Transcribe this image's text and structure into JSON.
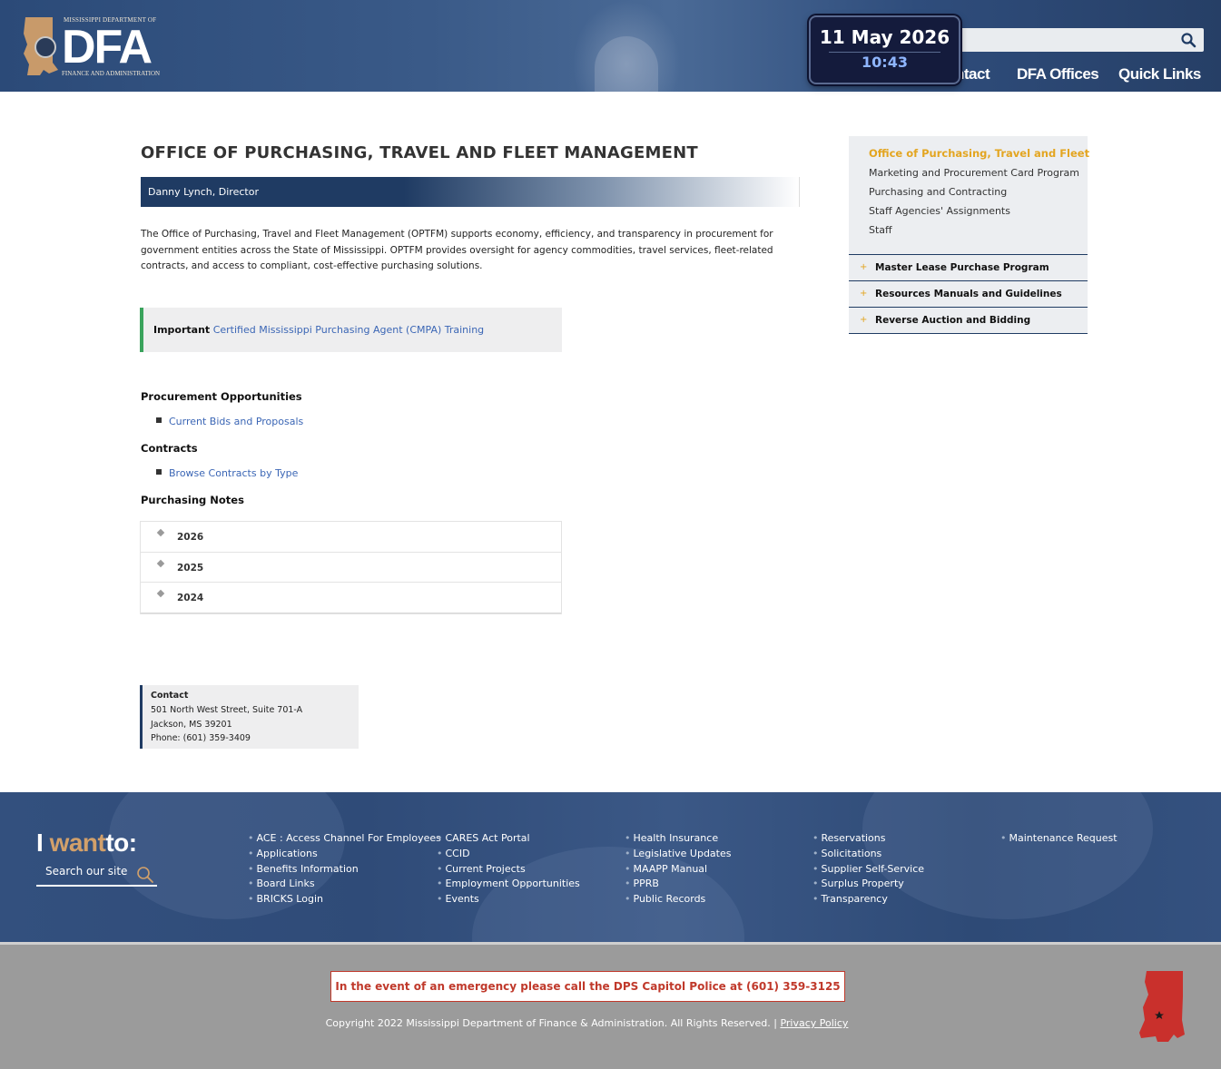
{
  "header": {
    "logo": {
      "top_text": "MISSISSIPPI DEPARTMENT OF",
      "big_text": "DFA",
      "bottom_text": "FINANCE AND ADMINISTRATION"
    },
    "search": {
      "placeholder": "",
      "icon": "search-icon"
    },
    "nav": [
      {
        "label": "ntact"
      },
      {
        "label": "DFA Offices"
      },
      {
        "label": "Quick Links"
      }
    ]
  },
  "clock": {
    "date": "11 May 2026",
    "time": "10:43"
  },
  "main": {
    "title": "OFFICE OF PURCHASING, TRAVEL AND FLEET MANAGEMENT",
    "director": "Danny Lynch, Director",
    "intro": "The Office of Purchasing, Travel and Fleet Management (OPTFM) supports economy, efficiency, and transparency in procurement for government entities across the State of Mississippi. OPTFM provides oversight for agency commodities, travel services, fleet-related contracts, and access to compliant, cost-effective purchasing solutions.",
    "important": {
      "label": "Important",
      "link": "Certified Mississippi Purchasing Agent (CMPA) Training"
    },
    "procurement": {
      "heading": "Procurement Opportunities",
      "link": "Current Bids and Proposals"
    },
    "contracts": {
      "heading": "Contracts",
      "link": "Browse Contracts by Type"
    },
    "notes": {
      "heading": "Purchasing Notes",
      "years": [
        "2026",
        "2025",
        "2024"
      ]
    },
    "contact": {
      "heading": "Contact",
      "line1": "501 North West Street, Suite 701-A",
      "line2": "Jackson, MS 39201",
      "line3": "Phone: (601) 359-3409"
    }
  },
  "sidebar": {
    "active": "Office of Purchasing, Travel and Fleet",
    "sub_items": [
      "Marketing and Procurement Card Program",
      "Purchasing and Contracting",
      "Staff Agencies' Assignments",
      "Staff"
    ],
    "accordions": [
      "Master Lease Purchase Program",
      "Resources Manuals and Guidelines",
      "Reverse Auction and Bidding"
    ],
    "plus_symbol": "+"
  },
  "footer": {
    "iwant_a": "I",
    "iwant_b": "want",
    "iwant_c": "to:",
    "search_label": "Search our site",
    "bullet": "•",
    "columns": [
      [
        "ACE : Access Channel For Employees",
        "Applications",
        "Benefits Information",
        "Board Links",
        "BRICKS Login"
      ],
      [
        "CARES Act Portal",
        "CCID",
        "Current Projects",
        "Employment Opportunities",
        "Events"
      ],
      [
        "Health Insurance",
        "Legislative Updates",
        "MAAPP Manual",
        "PPRB",
        "Public Records"
      ],
      [
        "Reservations",
        "Solicitations",
        "Supplier Self-Service",
        "Surplus Property",
        "Transparency"
      ],
      [
        "Maintenance Request"
      ]
    ]
  },
  "bottom": {
    "emergency": "In the event of an emergency please call the DPS Capitol Police at (601) 359-3125",
    "copyright": "Copyright 2022 Mississippi Department of Finance & Administration. All Rights Reserved. |",
    "privacy": "Privacy Policy"
  },
  "colors": {
    "navy": "#1f3b63",
    "gold": "#e3a520",
    "link": "#3b66b5",
    "green": "#3aa35c",
    "red": "#c0392b"
  }
}
